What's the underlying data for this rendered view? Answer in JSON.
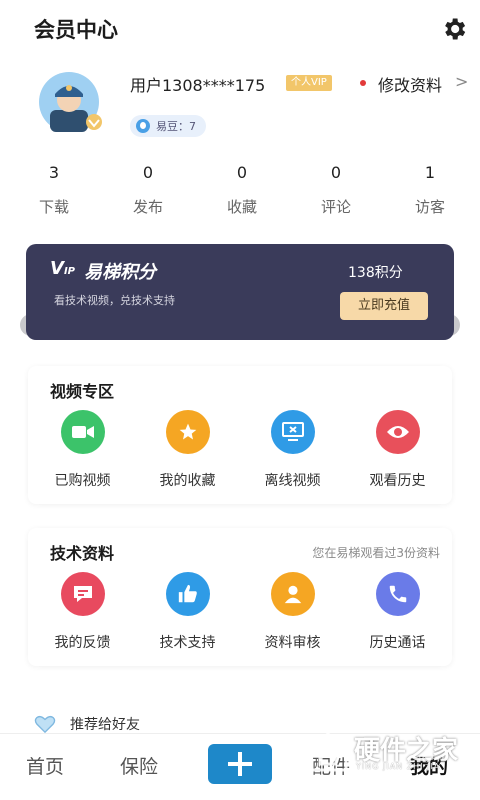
{
  "header": {
    "title": "会员中心",
    "settings_icon": "gear-icon"
  },
  "profile": {
    "avatar_icon": "user-avatar",
    "username": "用户1308****175",
    "vip_badge": "个人VIP",
    "edit_label": "修改资料",
    "edit_arrow": ">",
    "coins_label": "易豆：7"
  },
  "stats": [
    {
      "value": "3",
      "label": "下载"
    },
    {
      "value": "0",
      "label": "发布"
    },
    {
      "value": "0",
      "label": "收藏"
    },
    {
      "value": "0",
      "label": "评论"
    },
    {
      "value": "1",
      "label": "访客"
    }
  ],
  "points_banner": {
    "logo": "V",
    "logo_small": "IP",
    "title": "易梯积分",
    "subtitle": "看技术视频，兑技术支持",
    "points": "138积分",
    "button": "立即充值"
  },
  "video_section": {
    "title": "视频专区",
    "items": [
      {
        "label": "已购视频",
        "icon": "video-camera-icon",
        "color": "#3cc36a"
      },
      {
        "label": "我的收藏",
        "icon": "star-icon",
        "color": "#f5a623"
      },
      {
        "label": "离线视频",
        "icon": "monitor-icon",
        "color": "#2f9be6"
      },
      {
        "label": "观看历史",
        "icon": "eye-icon",
        "color": "#e8505b"
      }
    ]
  },
  "tech_section": {
    "title": "技术资料",
    "note": "您在易梯观看过3份资料",
    "items": [
      {
        "label": "我的反馈",
        "icon": "feedback-icon",
        "color": "#e84a5f"
      },
      {
        "label": "技术支持",
        "icon": "thumbs-up-icon",
        "color": "#2f9be6"
      },
      {
        "label": "资料审核",
        "icon": "user-review-icon",
        "color": "#f5a623"
      },
      {
        "label": "历史通话",
        "icon": "phone-icon",
        "color": "#6a7be8"
      }
    ]
  },
  "recommend": {
    "label": "推荐给好友"
  },
  "bottom_nav": {
    "home": "首页",
    "insurance": "保险",
    "parts": "配件",
    "mine": "我的"
  },
  "watermark": {
    "text": "硬件之家",
    "sub": "YING JIAN ZHI JIA"
  },
  "colors": {
    "banner_bg": "#3a3b5a",
    "banner_button": "#f7d9a8",
    "vip_badge": "#f2c66a",
    "plus_button": "#1e88c9"
  }
}
